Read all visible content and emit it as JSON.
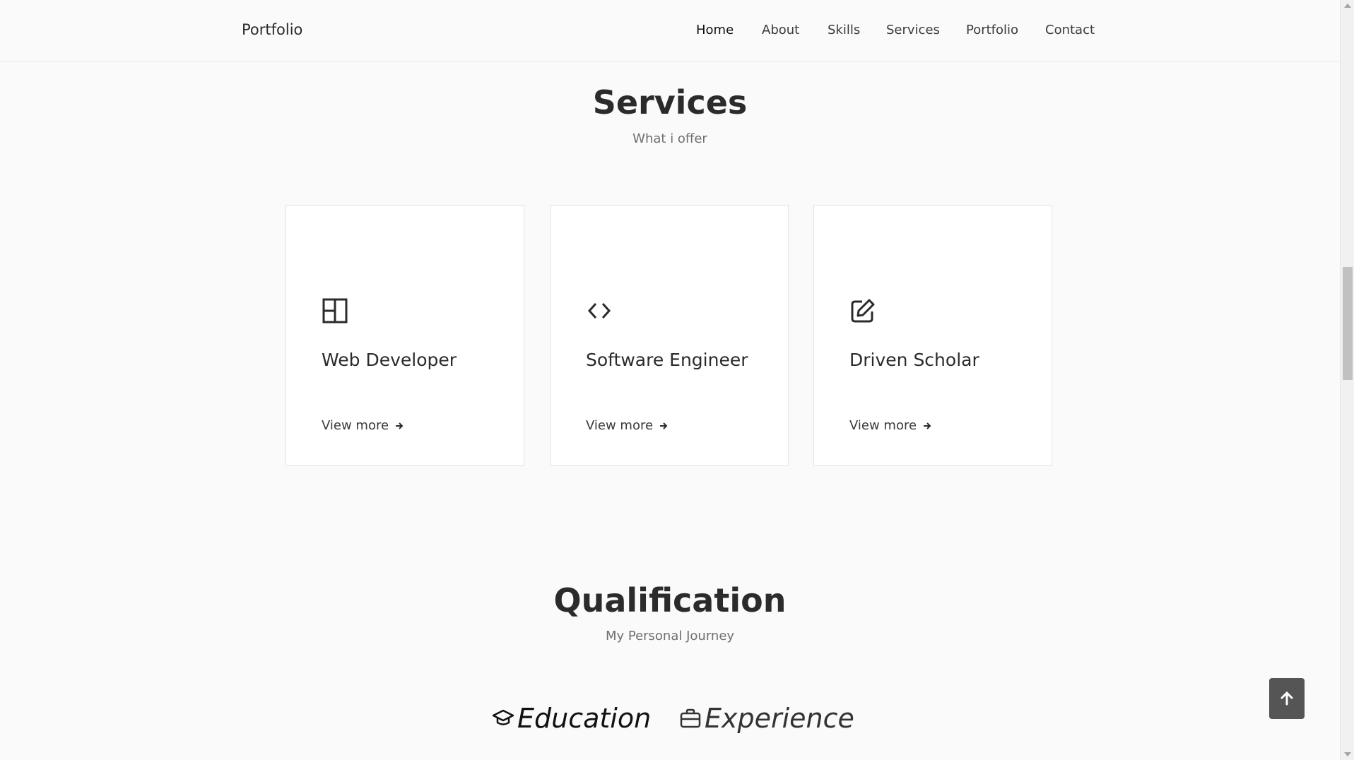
{
  "header": {
    "logo": "Portfolio",
    "nav": [
      {
        "label": "Home",
        "active": true
      },
      {
        "label": "About"
      },
      {
        "label": "Skills"
      },
      {
        "label": "Services"
      },
      {
        "label": "Portfolio"
      },
      {
        "label": "Contact"
      }
    ]
  },
  "services": {
    "title": "Services",
    "subtitle": "What i offer",
    "cards": [
      {
        "icon": "layout-icon",
        "title": "Web Developer",
        "link": "View more"
      },
      {
        "icon": "code-icon",
        "title": "Software Engineer",
        "link": "View more"
      },
      {
        "icon": "edit-icon",
        "title": "Driven Scholar",
        "link": "View more"
      }
    ]
  },
  "qualification": {
    "title": "Qualification",
    "subtitle": "My Personal Journey",
    "tabs": [
      {
        "icon": "graduation-cap-icon",
        "label": "Education",
        "active": true
      },
      {
        "icon": "briefcase-icon",
        "label": "Experience"
      }
    ]
  },
  "scroll_top": {
    "icon": "arrow-up-icon"
  },
  "colors": {
    "background": "#fafafa",
    "card": "#ffffff",
    "text": "#2b2b2b",
    "muted": "#6f6f6f",
    "scroll_button": "#555555"
  }
}
